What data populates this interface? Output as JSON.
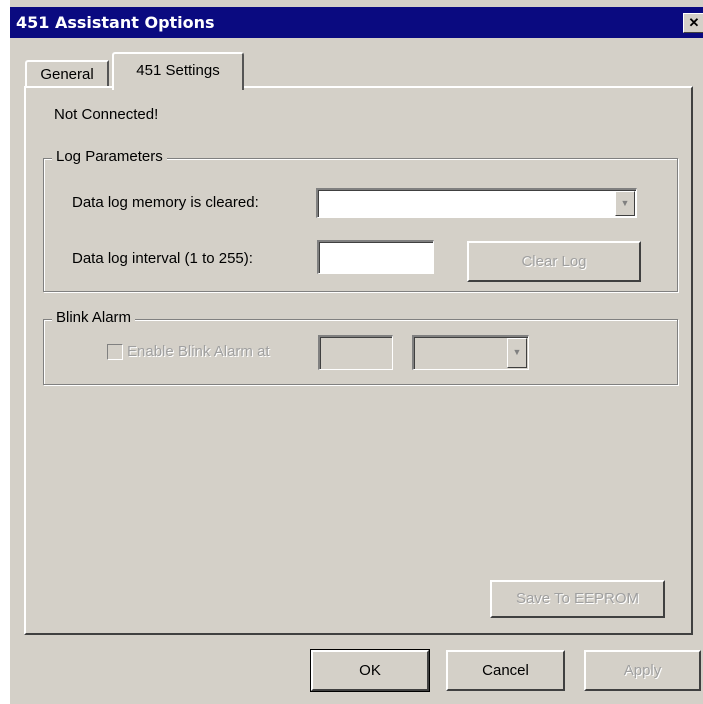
{
  "window": {
    "title": "451 Assistant Options",
    "close_icon": "close-x-icon",
    "close_glyph": "✕"
  },
  "tabs": [
    {
      "label": "General",
      "selected": false
    },
    {
      "label": "451 Settings",
      "selected": true
    }
  ],
  "status_text": "Not Connected!",
  "log_parameters": {
    "group_label": "Log Parameters",
    "memory_label": "Data log memory is cleared:",
    "memory_value": "",
    "interval_label": "Data log interval (1 to 255):",
    "interval_value": "",
    "clear_log_label": "Clear Log",
    "dropdown_arrow": "▼"
  },
  "blink_alarm": {
    "group_label": "Blink Alarm",
    "enable_label": "Enable Blink Alarm at",
    "enabled": false,
    "value": "",
    "unit_value": "",
    "dropdown_arrow": "▼"
  },
  "save_eeprom_label": "Save To EEPROM",
  "footer": {
    "ok_label": "OK",
    "cancel_label": "Cancel",
    "apply_label": "Apply"
  }
}
